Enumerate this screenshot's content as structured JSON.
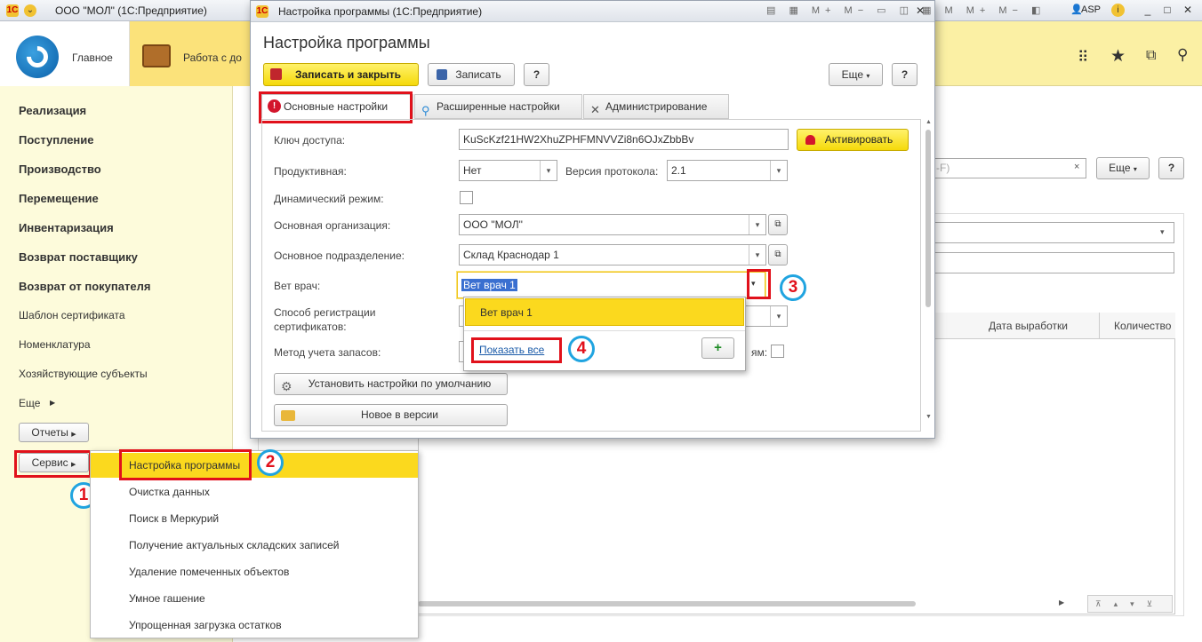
{
  "window": {
    "title": "ООО \"МОЛ\"  (1С:Предприятие)",
    "user": "ASP"
  },
  "sections": {
    "main": "Главное",
    "work": "Работа с до"
  },
  "sidebar": {
    "items": [
      {
        "label": "Реализация"
      },
      {
        "label": "Поступление"
      },
      {
        "label": "Производство"
      },
      {
        "label": "Перемещение"
      },
      {
        "label": "Инвентаризация"
      },
      {
        "label": "Возврат поставщику"
      },
      {
        "label": "Возврат от покупателя"
      },
      {
        "label": "Шаблон сертификата"
      },
      {
        "label": "Номенклатура"
      },
      {
        "label": "Хозяйствующие субъекты"
      },
      {
        "label": "Еще"
      }
    ],
    "reports": "Отчеты",
    "service": "Сервис"
  },
  "service_menu": {
    "items": [
      "Настройка программы",
      "Очистка данных",
      "Поиск в Меркурий",
      "Получение актуальных складских записей",
      "Удаление помеченных объектов",
      "Умное гашение",
      "Упрощенная загрузка остатков"
    ]
  },
  "background": {
    "search_hint": "-F)",
    "more": "Еще",
    "help": "?",
    "columns": [
      "Дата выработки",
      "Количество"
    ]
  },
  "dialog": {
    "window_title": "Настройка программы  (1С:Предприятие)",
    "heading": "Настройка программы",
    "save_close": "Записать и закрыть",
    "save": "Записать",
    "help": "?",
    "more": "Еще",
    "tabs": [
      "Основные настройки",
      "Расширенные настройки",
      "Администрирование"
    ],
    "form": {
      "access_key_label": "Ключ доступа:",
      "access_key_value": "KuScKzf21HW2XhuZPHFMNVVZi8n6OJxZbbBv",
      "activate": "Активировать",
      "productive_label": "Продуктивная:",
      "productive_value": "Нет",
      "protocol_label": "Версия протокола:",
      "protocol_value": "2.1",
      "dynamic_label": "Динамический режим:",
      "org_label": "Основная организация:",
      "org_value": "ООО \"МОЛ\"",
      "division_label": "Основное подразделение:",
      "division_value": "Склад Краснодар 1",
      "vet_label": "Вет врач:",
      "vet_value": "Вет врач 1",
      "cert_label_1": "Способ регистрации",
      "cert_label_2": "сертификатов:",
      "stock_label": "Метод учета запасов:",
      "stock_tail": "ям:",
      "defaults_btn": "Установить настройки по умолчанию",
      "new_version_btn": "Новое в версии"
    }
  },
  "dropdown": {
    "option": "Вет врач 1",
    "show_all": "Показать все",
    "add": "+"
  },
  "annotations": [
    "1",
    "2",
    "3",
    "4"
  ],
  "colors": {
    "accent_yellow": "#fbe27a",
    "highlight": "#fbd91e",
    "annotation_red": "#e1111b",
    "annotation_blue": "#20a4e0"
  }
}
